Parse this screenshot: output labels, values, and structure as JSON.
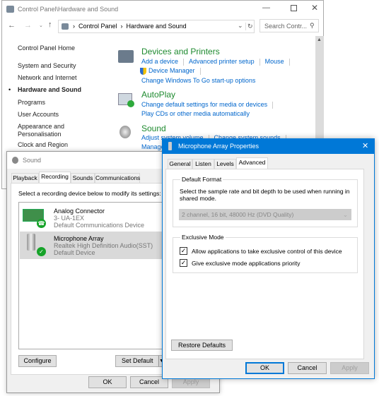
{
  "control_panel": {
    "title": "Control Panel\\Hardware and Sound",
    "breadcrumb": [
      "Control Panel",
      "Hardware and Sound"
    ],
    "search_placeholder": "Search Contr...",
    "nav": [
      "Control Panel Home",
      "System and Security",
      "Network and Internet",
      "Hardware and Sound",
      "Programs",
      "User Accounts",
      "Appearance and",
      "Personalisation",
      "Clock and Region"
    ],
    "sections": {
      "devices": {
        "title": "Devices and Printers",
        "links": [
          "Add a device",
          "Advanced printer setup",
          "Mouse",
          "Device Manager",
          "Change Windows To Go start-up options"
        ]
      },
      "autoplay": {
        "title": "AutoPlay",
        "links": [
          "Change default settings for media or devices",
          "Play CDs or other media automatically"
        ]
      },
      "sound": {
        "title": "Sound",
        "links": [
          "Adjust system volume",
          "Change system sounds",
          "Manage audio devices"
        ]
      }
    }
  },
  "sound_dialog": {
    "title": "Sound",
    "tabs": [
      "Playback",
      "Recording",
      "Sounds",
      "Communications"
    ],
    "active_tab": "Recording",
    "instruction": "Select a recording device below to modify its settings:",
    "devices": [
      {
        "name": "Analog Connector",
        "line2": "3- UA-1EX",
        "line3": "Default Communications Device",
        "badge": "phone-icon"
      },
      {
        "name": "Microphone Array",
        "line2": "Realtek High Definition Audio(SST)",
        "line3": "Default Device",
        "badge": "check-icon",
        "selected": true
      }
    ],
    "configure": "Configure",
    "set_default": "Set Default",
    "ok": "OK",
    "cancel": "Cancel",
    "apply": "Apply"
  },
  "props_dialog": {
    "title": "Microphone Array Properties",
    "tabs": [
      "General",
      "Listen",
      "Levels",
      "Advanced"
    ],
    "active_tab": "Advanced",
    "default_format": {
      "label": "Default Format",
      "description": "Select the sample rate and bit depth to be used when running in shared mode.",
      "selected": "2 channel, 16 bit, 48000 Hz (DVD Quality)"
    },
    "exclusive": {
      "label": "Exclusive Mode",
      "options": [
        {
          "label": "Allow applications to take exclusive control of this device",
          "checked": true
        },
        {
          "label": "Give exclusive mode applications priority",
          "checked": true
        }
      ]
    },
    "restore": "Restore Defaults",
    "ok": "OK",
    "cancel": "Cancel",
    "apply": "Apply",
    "accent": "#0078d7"
  }
}
